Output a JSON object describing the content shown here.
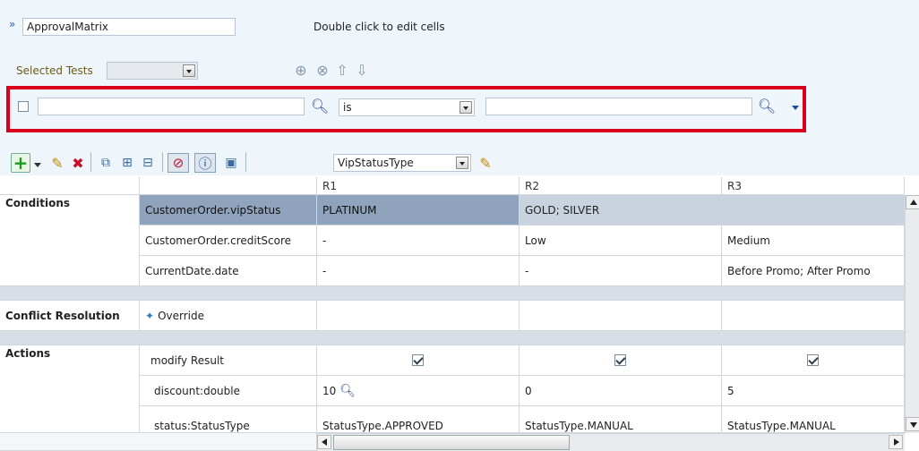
{
  "header": {
    "title_value": "ApprovalMatrix",
    "hint": "Double click to edit cells",
    "selected_tests_label": "Selected Tests"
  },
  "filter": {
    "left_value": "",
    "operator": "is",
    "right_value": ""
  },
  "toolbar": {
    "bucket_select": "VipStatusType"
  },
  "grid": {
    "columns": [
      "R1",
      "R2",
      "R3"
    ],
    "sections": {
      "conditions": "Conditions",
      "conflict": "Conflict Resolution",
      "actions": "Actions"
    },
    "conditions": [
      {
        "label": "CustomerOrder.vipStatus",
        "r1": "PLATINUM",
        "r2": "GOLD; SILVER",
        "r3": ""
      },
      {
        "label": "CustomerOrder.creditScore",
        "r1": "-",
        "r2": "Low",
        "r3": "Medium"
      },
      {
        "label": "CurrentDate.date",
        "r1": "-",
        "r2": "-",
        "r3": "Before Promo; After Promo"
      }
    ],
    "conflict_value": "Override",
    "actions": [
      {
        "label": "modify Result"
      },
      {
        "label": "discount:double",
        "r1": "10",
        "r2": "0",
        "r3": "5"
      },
      {
        "label": "status:StatusType",
        "r1": "StatusType.APPROVED",
        "r2": "StatusType.MANUAL",
        "r3": "StatusType.MANUAL"
      }
    ]
  },
  "colors": {
    "highlight_border": "#d9001b",
    "selected_cell": "#8fa3bd",
    "band": "#d8dee6"
  }
}
